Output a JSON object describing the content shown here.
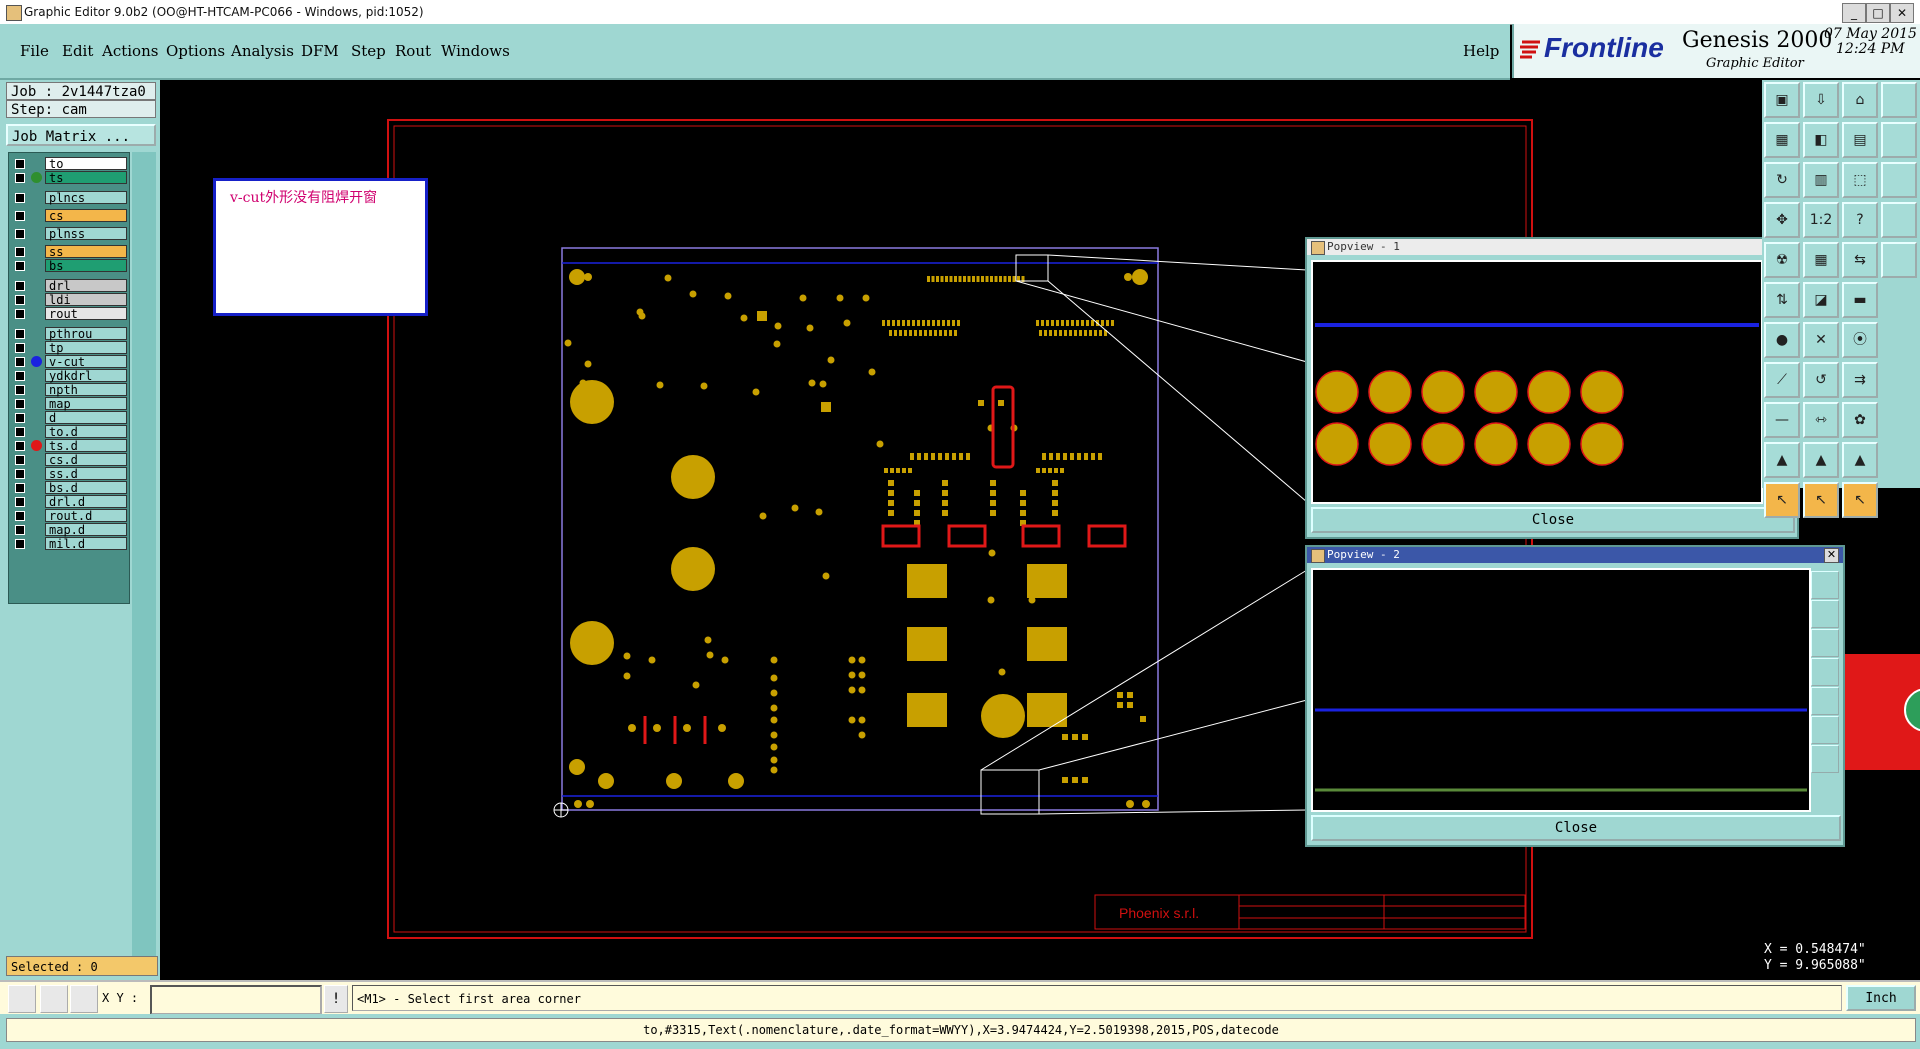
{
  "window": {
    "title": "Graphic Editor 9.0b2 (OO@HT-HTCAM-PC066 - Windows, pid:1052)"
  },
  "menu": {
    "items": [
      "File",
      "Edit",
      "Actions",
      "Options",
      "Analysis",
      "DFM",
      "Step",
      "Rout",
      "Windows"
    ],
    "help": "Help"
  },
  "brand": {
    "logo": "Frontline",
    "product": "Genesis 2000",
    "subtitle": "Graphic Editor",
    "date": "07 May 2015",
    "time": "12:24 PM"
  },
  "job": {
    "job_label": "Job : 2v1447tza0",
    "step_label": "Step: cam",
    "matrix_button": "Job Matrix ..."
  },
  "layers": [
    {
      "name": "to",
      "color": "#ffffff",
      "dot": ""
    },
    {
      "name": "ts",
      "color": "#1f9e72",
      "dot": "#2f8f2f"
    },
    {
      "name": "plncs",
      "color": "#9fd7d2",
      "dot": ""
    },
    {
      "name": "cs",
      "color": "#f3b64a",
      "dot": ""
    },
    {
      "name": "plnss",
      "color": "#9fd7d2",
      "dot": ""
    },
    {
      "name": "ss",
      "color": "#f3b64a",
      "dot": ""
    },
    {
      "name": "bs",
      "color": "#1f9e72",
      "dot": ""
    },
    {
      "name": "drl",
      "color": "#c8c8c8",
      "dot": ""
    },
    {
      "name": "ldi",
      "color": "#c8c8c8",
      "dot": ""
    },
    {
      "name": "rout",
      "color": "#e6e6e6",
      "dot": ""
    },
    {
      "name": "pthrou",
      "color": "#9fd7d2",
      "dot": ""
    },
    {
      "name": "tp",
      "color": "#9fd7d2",
      "dot": ""
    },
    {
      "name": "v-cut",
      "color": "#9fd7d2",
      "dot": "#1a22e0"
    },
    {
      "name": "ydkdrl",
      "color": "#9fd7d2",
      "dot": ""
    },
    {
      "name": "npth",
      "color": "#9fd7d2",
      "dot": ""
    },
    {
      "name": "map",
      "color": "#9fd7d2",
      "dot": ""
    },
    {
      "name": "d",
      "color": "#9fd7d2",
      "dot": ""
    },
    {
      "name": "to.d",
      "color": "#9fd7d2",
      "dot": ""
    },
    {
      "name": "ts.d",
      "color": "#9fd7d2",
      "dot": "#e01818"
    },
    {
      "name": "cs.d",
      "color": "#9fd7d2",
      "dot": ""
    },
    {
      "name": "ss.d",
      "color": "#9fd7d2",
      "dot": ""
    },
    {
      "name": "bs.d",
      "color": "#9fd7d2",
      "dot": ""
    },
    {
      "name": "drl.d",
      "color": "#9fd7d2",
      "dot": ""
    },
    {
      "name": "rout.d",
      "color": "#9fd7d2",
      "dot": ""
    },
    {
      "name": "map.d",
      "color": "#9fd7d2",
      "dot": ""
    },
    {
      "name": "mil.d",
      "color": "#9fd7d2",
      "dot": ""
    }
  ],
  "selected": "Selected : 0",
  "annotation": "v-cut外形没有阻焊开窗",
  "title_block": {
    "company": "Phoenix s.r.l."
  },
  "popview1": {
    "title": "Popview - 1",
    "close": "Close"
  },
  "popview2": {
    "title": "Popview - 2",
    "close": "Close"
  },
  "coords": {
    "x": "X = 0.548474\"",
    "y": "Y = 9.965088\""
  },
  "command": {
    "xy_label": "X Y :",
    "xy_value": "",
    "prompt": "<M1> - Select first area corner",
    "units": "Inch"
  },
  "status": "to,#3315,Text(.nomenclature,.date_format=WWYY),X=3.9474424,Y=2.5019398,2015,POS,datecode",
  "colors": {
    "teal": "#9fd7d2",
    "pad": "#c8a000",
    "board_outline": "#6a5acd",
    "frame": "#d01010",
    "vcut": "#1a22e0"
  }
}
